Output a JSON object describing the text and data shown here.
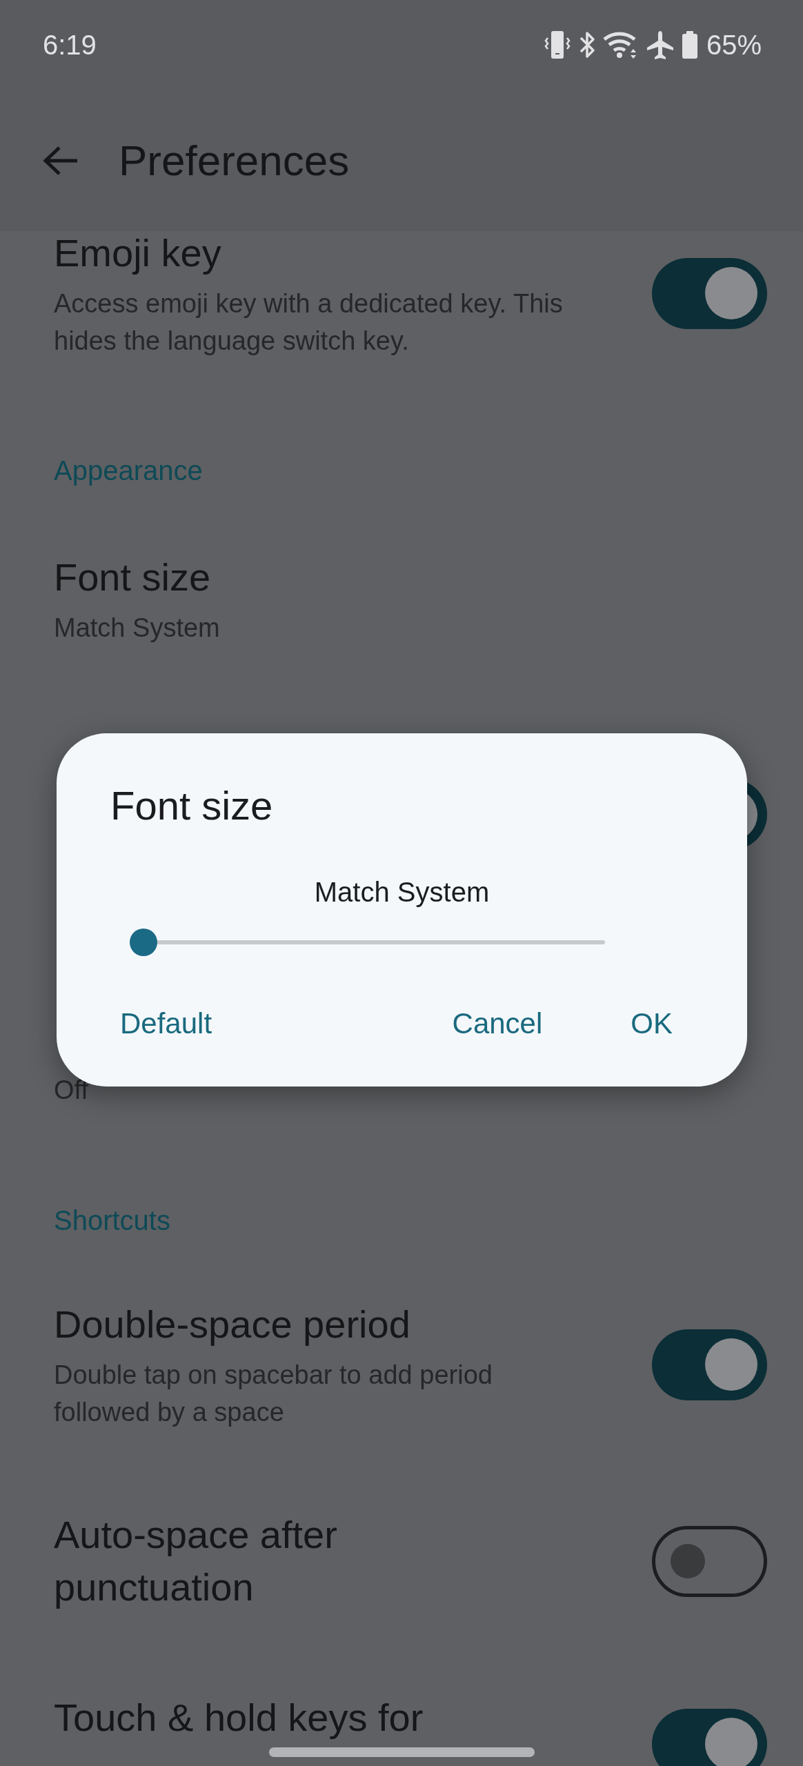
{
  "status_bar": {
    "time": "6:19",
    "battery": "65%"
  },
  "app_bar": {
    "title": "Preferences"
  },
  "settings": [
    {
      "kind": "toggle",
      "title": "Emoji key",
      "subtitle": "Access emoji key with a dedicated key. This hides the language switch key.",
      "on": true
    },
    {
      "kind": "header",
      "title": "Appearance"
    },
    {
      "kind": "value",
      "title": "Font size",
      "subtitle": "Match System"
    },
    {
      "kind": "toggle",
      "on": true
    },
    {
      "kind": "value",
      "subtitle": "Off"
    },
    {
      "kind": "header",
      "title": "Shortcuts"
    },
    {
      "kind": "toggle",
      "title": "Double-space period",
      "subtitle": "Double tap on spacebar to add period followed by a space",
      "on": true
    },
    {
      "kind": "toggle",
      "title": "Auto-space after punctuation",
      "on": false
    },
    {
      "kind": "toggle",
      "title": "Touch & hold keys for",
      "on": true
    }
  ],
  "dialog": {
    "title": "Font size",
    "value_label": "Match System",
    "slider": {
      "level": 0
    },
    "buttons": [
      "Default",
      "Cancel",
      "OK"
    ]
  }
}
